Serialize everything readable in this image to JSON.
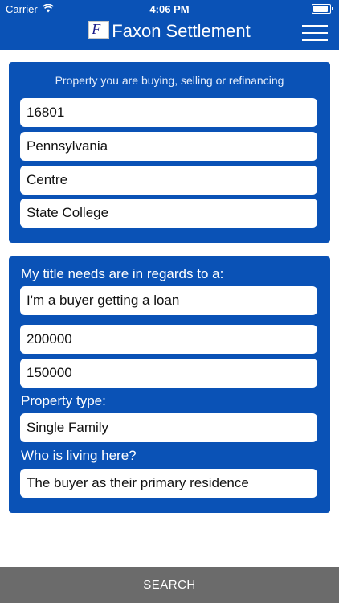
{
  "status_bar": {
    "carrier": "Carrier",
    "time": "4:06 PM",
    "battery_level": 1.0
  },
  "header": {
    "title": "Faxon Settlement",
    "logo_letter": "F"
  },
  "location_card": {
    "caption": "Property you are buying, selling or refinancing",
    "fields": [
      "16801",
      "Pennsylvania",
      "Centre",
      "State College"
    ]
  },
  "needs_card": {
    "title_needs_label": "My title needs are in regards to a:",
    "title_needs_value": "I'm a buyer getting a loan",
    "purchase_price": "200000",
    "loan_amount": "150000",
    "property_type_label": "Property type:",
    "property_type_value": "Single Family",
    "occupancy_label": "Who is living here?",
    "occupancy_value": "The buyer as their primary residence"
  },
  "footer": {
    "search_label": "SEARCH"
  },
  "colors": {
    "brand_blue": "#0a52b6",
    "footer_gray": "#6b6b6b"
  }
}
